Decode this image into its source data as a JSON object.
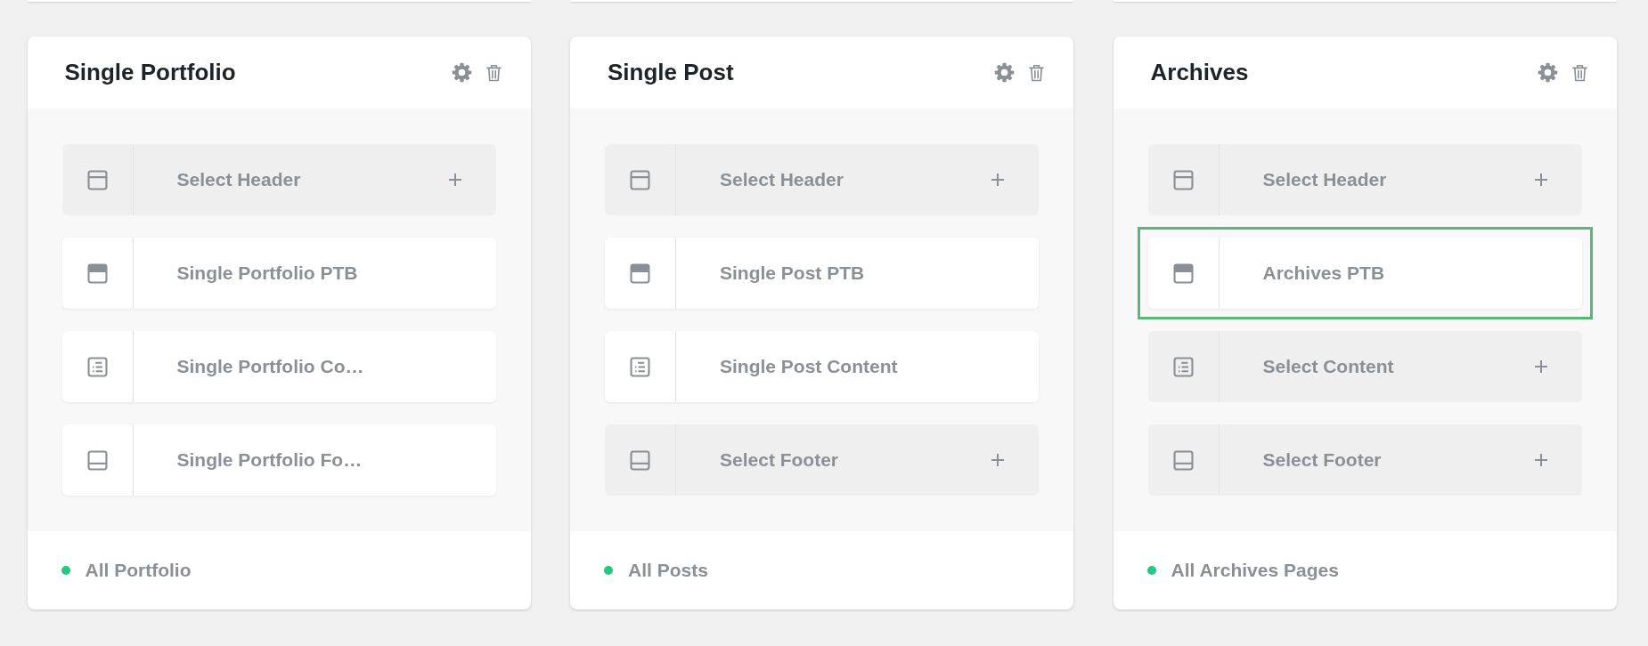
{
  "cards": [
    {
      "title": "Single Portfolio",
      "rows": [
        {
          "kind": "header",
          "label": "Select Header",
          "assigned": false,
          "selected": false
        },
        {
          "kind": "ptb",
          "label": "Single Portfolio PTB",
          "assigned": true,
          "selected": false
        },
        {
          "kind": "content",
          "label": "Single Portfolio Co…",
          "assigned": true,
          "selected": false
        },
        {
          "kind": "footer",
          "label": "Single Portfolio Fo…",
          "assigned": true,
          "selected": false
        }
      ],
      "footer": "All Portfolio"
    },
    {
      "title": "Single Post",
      "rows": [
        {
          "kind": "header",
          "label": "Select Header",
          "assigned": false,
          "selected": false
        },
        {
          "kind": "ptb",
          "label": "Single Post PTB",
          "assigned": true,
          "selected": false
        },
        {
          "kind": "content",
          "label": "Single Post Content",
          "assigned": true,
          "selected": false
        },
        {
          "kind": "footer",
          "label": "Select Footer",
          "assigned": false,
          "selected": false
        }
      ],
      "footer": "All Posts"
    },
    {
      "title": "Archives",
      "rows": [
        {
          "kind": "header",
          "label": "Select Header",
          "assigned": false,
          "selected": false
        },
        {
          "kind": "ptb",
          "label": "Archives PTB",
          "assigned": true,
          "selected": true
        },
        {
          "kind": "content",
          "label": "Select Content",
          "assigned": false,
          "selected": false
        },
        {
          "kind": "footer",
          "label": "Select Footer",
          "assigned": false,
          "selected": false
        }
      ],
      "footer": "All Archives Pages"
    }
  ]
}
